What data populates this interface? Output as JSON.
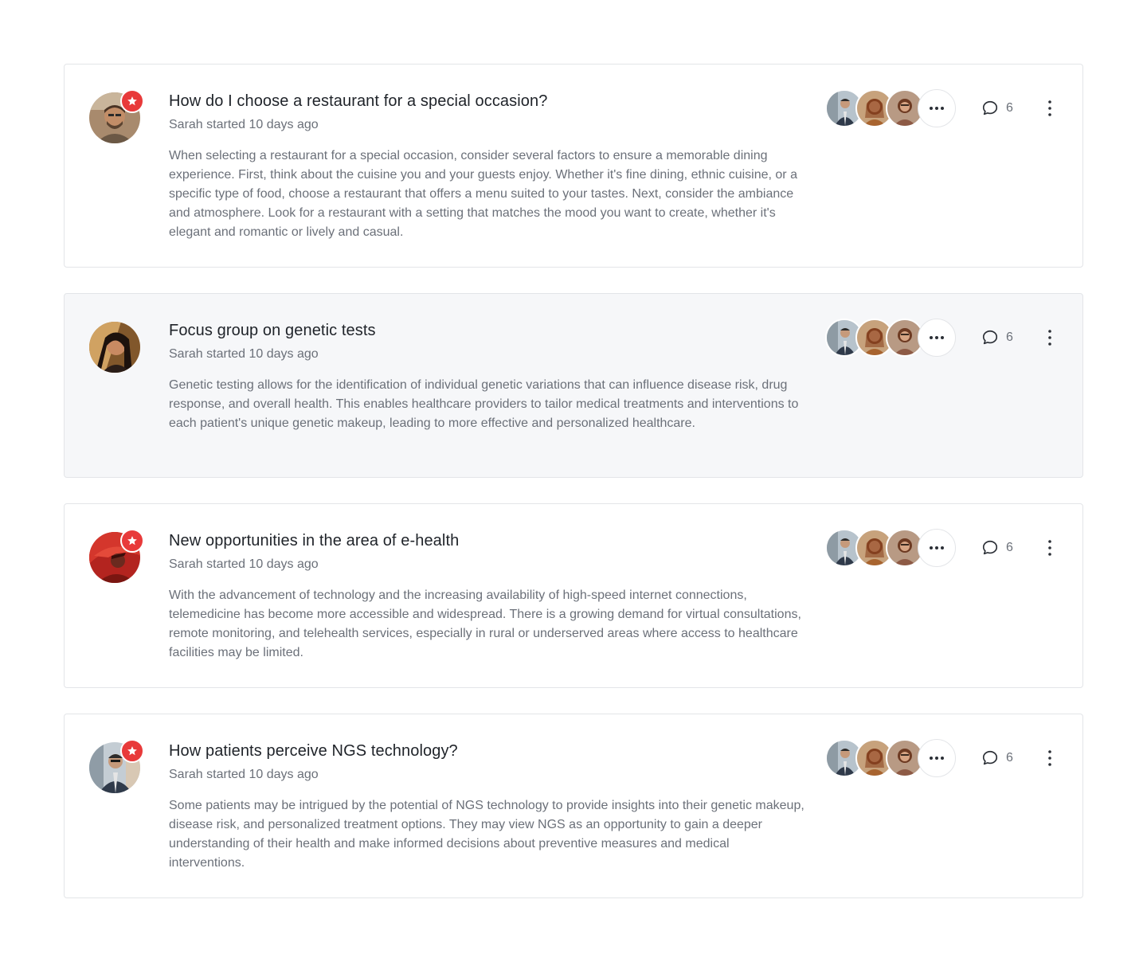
{
  "discussions": [
    {
      "title": "How do I choose a restaurant for a special occasion?",
      "meta": "Sarah started 10 days ago",
      "body": "When selecting a restaurant for a special occasion, consider several factors to ensure a memorable dining experience. First, think about the cuisine you and your guests enjoy. Whether it's fine dining, ethnic cuisine, or a specific type of food, choose a restaurant that offers a menu suited to your tastes. Next, consider the ambiance and atmosphere. Look for a restaurant with a setting that matches the mood you want to create, whether it's elegant and romantic or lively and casual.",
      "comment_count": "6",
      "featured": true,
      "highlighted": false
    },
    {
      "title": "Focus group on genetic tests",
      "meta": "Sarah started 10 days ago",
      "body": "Genetic testing allows for the identification of individual genetic variations that can influence disease risk, drug response, and overall health. This enables healthcare providers to tailor medical treatments and interventions to each patient's unique genetic makeup, leading to more effective and personalized healthcare.",
      "comment_count": "6",
      "featured": false,
      "highlighted": true
    },
    {
      "title": "New opportunities in the area of e-health",
      "meta": "Sarah started 10 days ago",
      "body": "With the advancement of technology and the increasing availability of high-speed internet connections, telemedicine has become more accessible and widespread. There is a growing demand for virtual consultations, remote monitoring, and telehealth services, especially in rural or underserved areas where access to healthcare facilities may be limited.",
      "comment_count": "6",
      "featured": true,
      "highlighted": false
    },
    {
      "title": "How patients perceive NGS technology?",
      "meta": "Sarah started 10 days ago",
      "body": "Some patients may be intrigued by the potential of NGS technology to provide insights into their genetic makeup, disease risk, and personalized treatment options. They may view NGS as an opportunity to gain a deeper understanding of their health and make informed decisions about preventive measures and medical interventions.",
      "comment_count": "6",
      "featured": true,
      "highlighted": false
    }
  ],
  "icons": {
    "star_badge": "star-icon",
    "more_participants": "more-horizontal-icon",
    "comments": "speech-bubble-icon",
    "options": "more-vertical-icon"
  },
  "colors": {
    "badge": "#e83a3a",
    "card_border": "#e3e5e8",
    "highlight_bg": "#f6f7f9",
    "title": "#1f2329",
    "muted_text": "#6b7079"
  }
}
